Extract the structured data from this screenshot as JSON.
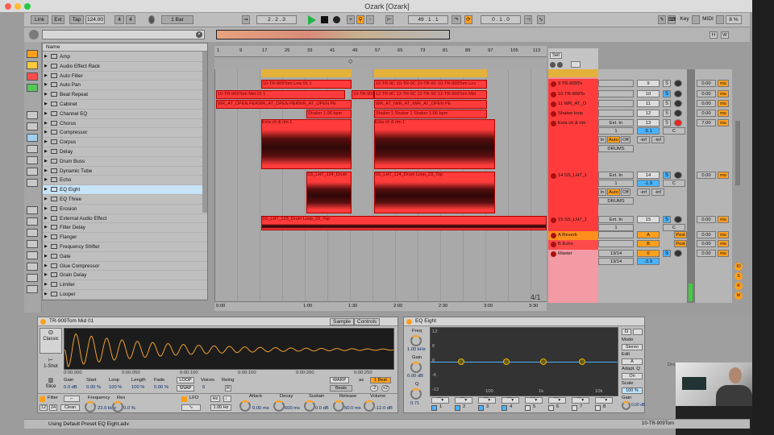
{
  "window": {
    "title": "Ozark  [Ozark]"
  },
  "control_bar": {
    "link": "Link",
    "ext": "Ext",
    "tap": "Tap",
    "tempo": "124.00",
    "time_sig_num": "4",
    "time_sig_den": "4",
    "quantize": "1 Bar",
    "position": "2 . 2 . 3",
    "loop_start": "49 . 1 . 1",
    "loop_length": "0 . 1 . 0",
    "key": "Key",
    "midi": "MIDI",
    "cpu": "8 %",
    "hw": "H",
    "w": "W"
  },
  "browser": {
    "header": "Name",
    "items": [
      "Amp",
      "Audio Effect Rack",
      "Auto Filter",
      "Auto Pan",
      "Beat Repeat",
      "Cabinet",
      "Channel EQ",
      "Chorus",
      "Compressor",
      "Corpus",
      "Delay",
      "Drum Buss",
      "Dynamic Tube",
      "Echo",
      "EQ Eight",
      "EQ Three",
      "Erosion",
      "External Audio Effect",
      "Filter Delay",
      "Flanger",
      "Frequency Shifter",
      "Gate",
      "Glue Compressor",
      "Grain Delay",
      "Limiter",
      "Looper"
    ],
    "selected": "EQ Eight"
  },
  "ruler": {
    "bars": [
      "1",
      "9",
      "17",
      "25",
      "33",
      "41",
      "49",
      "57",
      "65",
      "73",
      "81",
      "89",
      "97",
      "105",
      "113"
    ],
    "times": [
      "0:00",
      "1:00",
      "1:30",
      "2:00",
      "2:30",
      "3:00",
      "3:30"
    ],
    "set": "Set",
    "page": "4/1"
  },
  "clips": {
    "tom_low": "10-TR-909Tom Low 01 1",
    "tom_mid_a": "10-TR-909Tom Mid 01 1",
    "tom_mid_b": "10-TR-909Tom Mid 01 1",
    "tom_mid_c": "12-TR-9C 12-TR-9C 12-TR-9C 12-TR-909Tom Mid",
    "tom_low_b": "10-TR-9C 10-TR-9C 10-TR-9C 10-TR-909Tom Lov",
    "wr": "WR_AT_OPEN PERWR_AT_OPEN PERWR_AT_OPEN PE",
    "wr_b": "WR_AT_IWR_AT_IWR_AT_OPEN PE",
    "shaker_a": "Shaker 1-96 bpm",
    "shaker_b": "Shaker 1 Shaker 1 Shaker 1-96 bpm",
    "exta_a": "Exta ch & rim 1",
    "exta_b": "Exta ch & rim 1",
    "ss_lh7_a": "SS_LH7_124_Drum",
    "ss_lh7_b": "SS_LH7_124_Drum Loop_23_Top",
    "ss_lh7_c": "SS_LH7_123_Drum Loop_23_Top"
  },
  "tracks": [
    {
      "name": "9 TR-909To",
      "num": "9",
      "vol": "0.00",
      "ms": "ms"
    },
    {
      "name": "10 TR-909To",
      "num": "10",
      "vol": "0.00",
      "ms": "ms"
    },
    {
      "name": "11 WR_AT_O",
      "num": "11",
      "vol": "0.00",
      "ms": "ms"
    },
    {
      "name": "Shaker loop",
      "num": "12",
      "vol": "0.00",
      "ms": "ms"
    },
    {
      "name": "Exta ch & rim",
      "num": "13",
      "vol": "7.00",
      "ms": "ms",
      "input": "Ext. In",
      "ch": "1",
      "db": "-5.1",
      "c": "C",
      "in": "In",
      "auto": "Auto",
      "off": "Off",
      "inf1": "-inf",
      "inf2": "-inf",
      "route": "DRUMS"
    },
    {
      "name": "14 SS_LH7_1",
      "num": "14",
      "vol": "0.00",
      "ms": "ms",
      "input": "Ext. In",
      "ch": "1",
      "db": "-1.9",
      "c": "C",
      "in": "In",
      "auto": "Auto",
      "off": "Off",
      "inf1": "-inf",
      "inf2": "-inf",
      "route": "DRUMS"
    },
    {
      "name": "15 SS_LH7_1",
      "num": "15",
      "vol": "0.00",
      "ms": "ms",
      "input": "Ext. In",
      "ch": "1",
      "c": "C"
    },
    {
      "name": "A Reverb",
      "num": "A",
      "post": "Post",
      "vol": "0.00",
      "ms": "ms"
    },
    {
      "name": "B Echo",
      "num": "B",
      "post": "Post",
      "vol": "0.00",
      "ms": "ms"
    },
    {
      "name": "Master",
      "num": "0",
      "vol": "0.00",
      "ms": "ms",
      "out1": "13/14",
      "out2": "13/14",
      "db": "-3.9"
    }
  ],
  "simpler": {
    "title": "TR-909Tom Mid 01",
    "sample": "Sample",
    "controls": "Controls",
    "mode": "Classic",
    "oneshot": "1-Shot",
    "slice": "Slice",
    "gain_l": "Gain",
    "gain": "0.0 dB",
    "start_l": "Start",
    "start": "0.00 %",
    "loop_l": "Loop",
    "loop": "100 %",
    "length_l": "Length",
    "length": "100 %",
    "fade_l": "Fade",
    "fade": "0.00 %",
    "loopbtn": "LOOP",
    "snap": "SNAP",
    "voices_l": "Voices",
    "voices": "6",
    "retrig_l": "Retrig",
    "retrig": "R",
    "warp": "WARP",
    "as": "as",
    "beat": "1 Beat",
    "beats": "Beats",
    "x2": "x2",
    "d2": ":2",
    "times": [
      "0:00:000",
      "0:00:050",
      "0:00:100",
      "0:00:150",
      "0:00:200",
      "0:00:250"
    ],
    "filter": "Filter",
    "f12": "12",
    "f24": "24",
    "clean": "Clean",
    "freq_l": "Frequency",
    "freq": "22.0 kHz",
    "res_l": "Res",
    "res": "0.0 %",
    "lfo": "LFO",
    "hz": "Hz",
    "lfo_rate": "1.00 Hz",
    "attack_l": "Attack",
    "attack": "0.00 ms",
    "decay_l": "Decay",
    "decay": "600 ms",
    "sustain_l": "Sustain",
    "sustain": "0.0 dB",
    "release_l": "Release",
    "release": "50.0 ms",
    "volume_l": "Volume",
    "volume": "-12.0 dB"
  },
  "eq": {
    "title": "EQ Eight",
    "freq_l": "Freq",
    "freq": "1.00 kHz",
    "gain_l": "Gain",
    "gain": "0.00 dB",
    "q_l": "Q",
    "q": "0.71",
    "db_labels": [
      "12",
      "6",
      "0",
      "-6",
      "-12"
    ],
    "freq_labels": [
      "100",
      "1k",
      "10k"
    ],
    "mode_l": "Mode",
    "mode": "Stereo",
    "edit_l": "Edit",
    "edit": "A",
    "adapt_l": "Adapt. Q",
    "adapt": "On",
    "scale_l": "Scale",
    "scale": "100 %",
    "gain2_l": "Gain",
    "gain2": "0.00 dB",
    "bands": [
      "1",
      "2",
      "3",
      "4",
      "5",
      "6",
      "7",
      "8"
    ]
  },
  "drop_hint": "Dro",
  "status": {
    "text": "Using Default Preset EQ Eight.adv.",
    "right": "10-TR-909Tom"
  }
}
